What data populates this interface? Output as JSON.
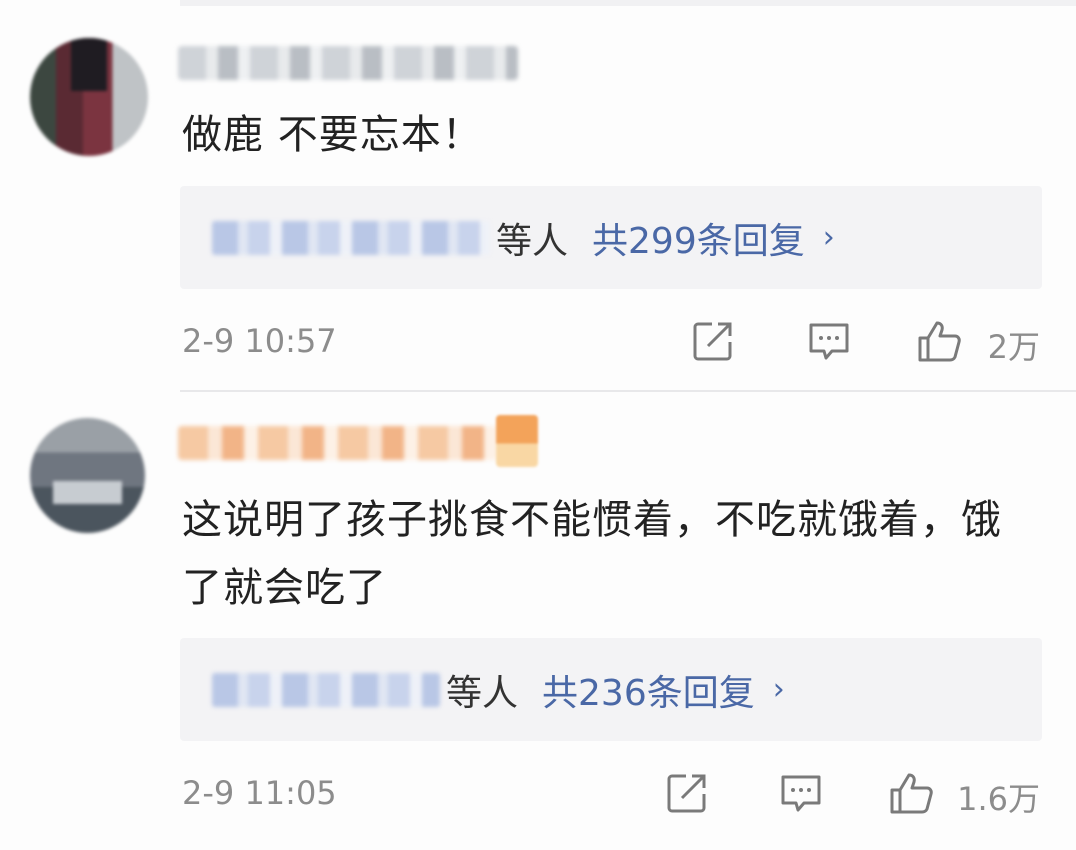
{
  "comments": [
    {
      "text": "做鹿 不要忘本！",
      "reply_etc": "等人",
      "reply_count": "共299条回复",
      "reply_chevron": "›",
      "timestamp": "2-9 10:57",
      "like_count": "2万",
      "icons": [
        "share-icon",
        "comment-icon",
        "like-icon"
      ]
    },
    {
      "text": "这说明了孩子挑食不能惯着，不吃就饿着，饿了就会吃了",
      "reply_etc": "等人",
      "reply_count": "共236条回复",
      "reply_chevron": "›",
      "timestamp": "2-9 11:05",
      "like_count": "1.6万",
      "icons": [
        "share-icon",
        "comment-icon",
        "like-icon"
      ]
    }
  ],
  "colors": {
    "link": "#4a68a6",
    "meta": "#8c8c8c",
    "reply_bg": "#f3f3f5",
    "text": "#222222"
  }
}
